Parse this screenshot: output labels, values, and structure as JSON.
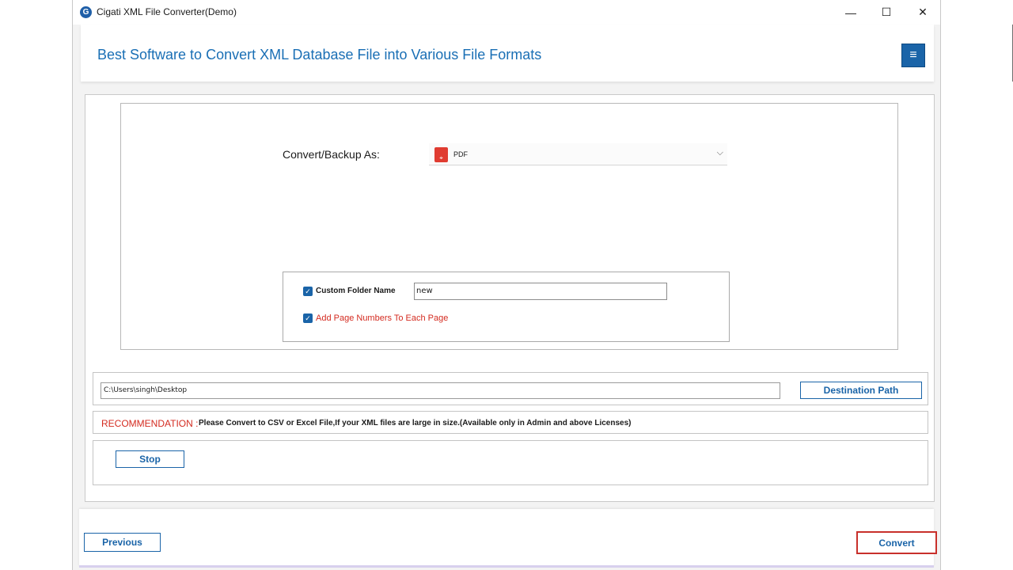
{
  "window": {
    "title": "Cigati XML File Converter(Demo)",
    "app_icon_letter": "G",
    "minimize_glyph": "—",
    "maximize_glyph": "☐",
    "close_glyph": "✕"
  },
  "header": {
    "title": "Best Software to Convert XML Database File into Various File Formats",
    "menu_glyph": "≡"
  },
  "conversion": {
    "label": "Convert/Backup As:",
    "selected_format": "PDF",
    "format_icon": "pdf-icon",
    "chevron": "⌵"
  },
  "options": {
    "custom_folder": {
      "label": "Custom Folder Name",
      "checked": true,
      "value": "new"
    },
    "page_numbers": {
      "label": "Add Page Numbers To Each Page",
      "checked": true
    },
    "check_glyph": "✓"
  },
  "destination": {
    "path": "C:\\Users\\singh\\Desktop",
    "button_label": "Destination Path"
  },
  "recommendation": {
    "label": "RECOMMENDATION :",
    "text": "Please Convert to CSV or Excel File,If your XML files are large in size.(Available only in Admin and above Licenses)"
  },
  "actions": {
    "stop_label": "Stop",
    "previous_label": "Previous",
    "convert_label": "Convert"
  },
  "colors": {
    "accent": "#1a64a8",
    "title_blue": "#1a6fb5",
    "warning_red": "#d42b20",
    "convert_border": "#c8302b"
  }
}
